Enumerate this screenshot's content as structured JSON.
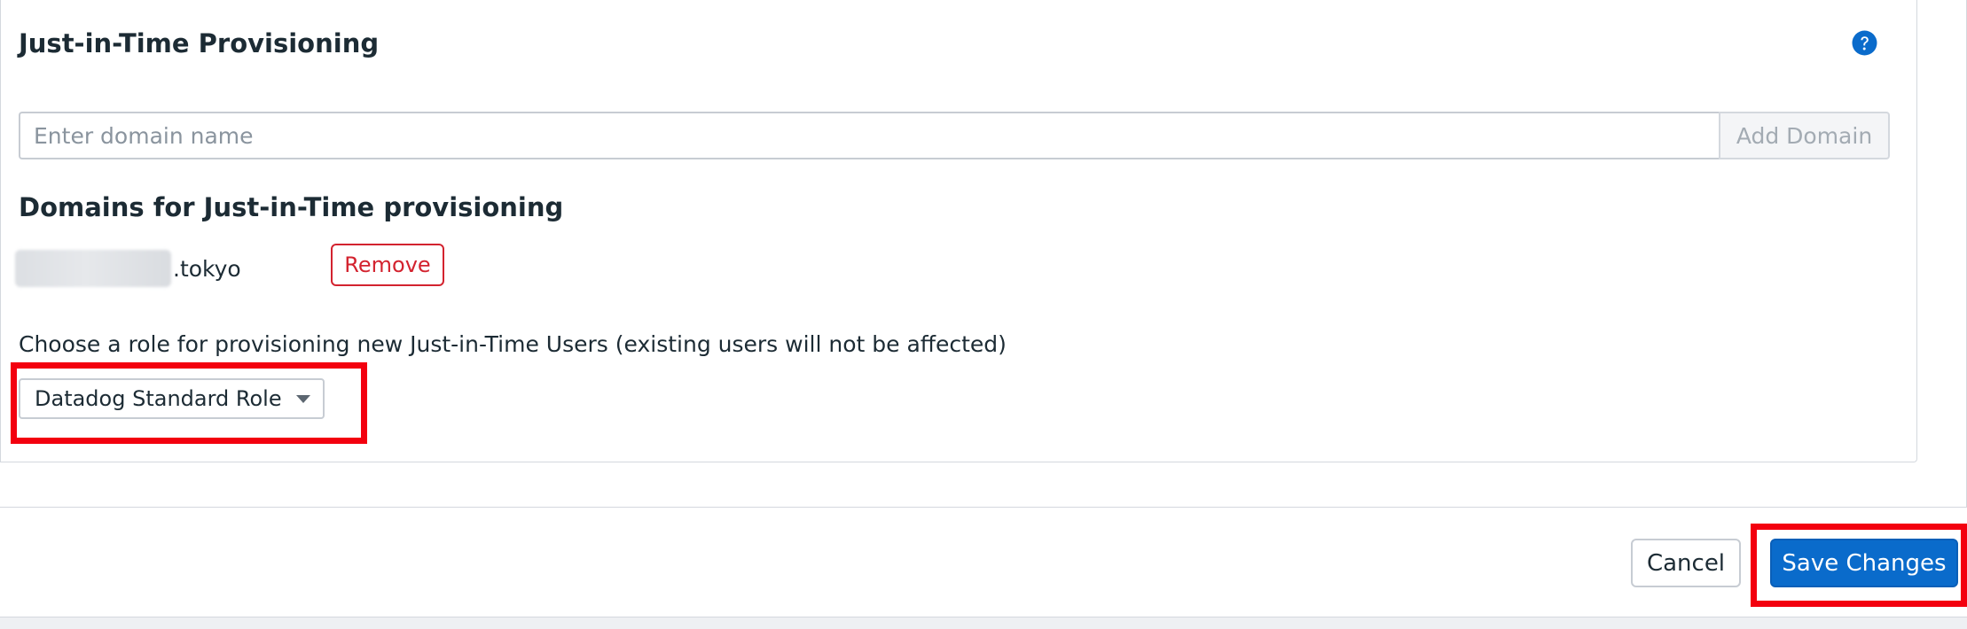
{
  "jit": {
    "title": "Just-in-Time Provisioning",
    "help_icon": "question-circle-icon",
    "domain_input": {
      "placeholder": "Enter domain name",
      "value": ""
    },
    "add_domain_label": "Add Domain",
    "domains_heading": "Domains for Just-in-Time provisioning",
    "domains": [
      {
        "suffix": ".tokyo",
        "remove_label": "Remove"
      }
    ],
    "role_label": "Choose a role for provisioning new Just-in-Time Users (existing users will not be affected)",
    "role_select": {
      "selected": "Datadog Standard Role"
    }
  },
  "footer": {
    "cancel_label": "Cancel",
    "save_label": "Save Changes"
  },
  "colors": {
    "primary": "#0a6bcb",
    "danger": "#d3232f",
    "highlight": "#f3000f"
  }
}
